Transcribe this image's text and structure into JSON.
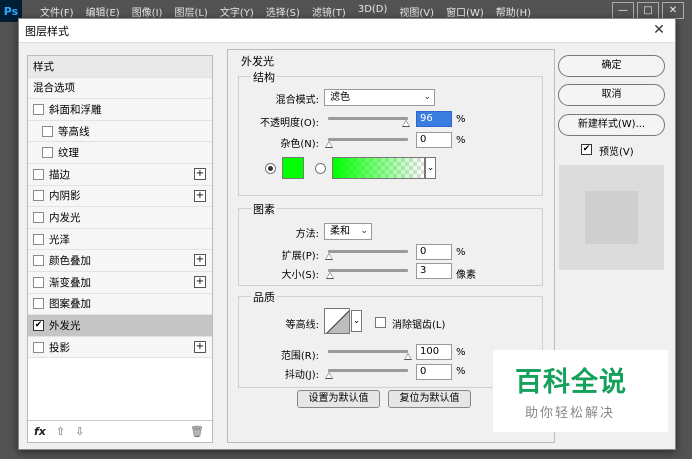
{
  "app": {
    "logo": "Ps",
    "menu": [
      "文件(F)",
      "编辑(E)",
      "图像(I)",
      "图层(L)",
      "文字(Y)",
      "选择(S)",
      "滤镜(T)",
      "3D(D)",
      "视图(V)",
      "窗口(W)",
      "帮助(H)"
    ],
    "window_controls": [
      "—",
      "□",
      "✕"
    ]
  },
  "dialog": {
    "title": "图层样式",
    "close": "✕",
    "style_list": {
      "header": "样式",
      "blend": "混合选项",
      "items": [
        {
          "label": "斜面和浮雕",
          "checked": false,
          "plus": false,
          "indent": false
        },
        {
          "label": "等高线",
          "checked": false,
          "plus": false,
          "indent": true
        },
        {
          "label": "纹理",
          "checked": false,
          "plus": false,
          "indent": true
        },
        {
          "label": "描边",
          "checked": false,
          "plus": true,
          "indent": false
        },
        {
          "label": "内阴影",
          "checked": false,
          "plus": true,
          "indent": false
        },
        {
          "label": "内发光",
          "checked": false,
          "plus": false,
          "indent": false
        },
        {
          "label": "光泽",
          "checked": false,
          "plus": false,
          "indent": false
        },
        {
          "label": "颜色叠加",
          "checked": false,
          "plus": true,
          "indent": false
        },
        {
          "label": "渐变叠加",
          "checked": false,
          "plus": true,
          "indent": false
        },
        {
          "label": "图案叠加",
          "checked": false,
          "plus": false,
          "indent": false
        },
        {
          "label": "外发光",
          "checked": true,
          "plus": false,
          "indent": false
        },
        {
          "label": "投影",
          "checked": false,
          "plus": true,
          "indent": false
        }
      ],
      "footer": {
        "fx": "fx",
        "up": "⇧",
        "down": "⇩",
        "trash": "🗑"
      }
    },
    "panel_title": "外发光",
    "structure": {
      "title": "结构",
      "blend_mode_label": "混合模式:",
      "blend_mode_value": "滤色",
      "opacity_label": "不透明度(O):",
      "opacity_value": "96",
      "noise_label": "杂色(N):",
      "noise_value": "0",
      "percent": "%",
      "color": "#00ff00",
      "gradient_color": "#00ff00"
    },
    "elements": {
      "title": "图素",
      "method_label": "方法:",
      "method_value": "柔和",
      "spread_label": "扩展(P):",
      "spread_value": "0",
      "size_label": "大小(S):",
      "size_value": "3",
      "px_unit": "像素",
      "percent": "%"
    },
    "quality": {
      "title": "品质",
      "contour_label": "等高线:",
      "antialias_label": "消除锯齿(L)",
      "range_label": "范围(R):",
      "range_value": "100",
      "jitter_label": "抖动(J):",
      "jitter_value": "0",
      "percent": "%"
    },
    "buttons": {
      "set_default": "设置为默认值",
      "reset_default": "复位为默认值",
      "ok": "确定",
      "cancel": "取消",
      "new_style": "新建样式(W)...",
      "preview_label": "预览(V)"
    }
  },
  "watermark": {
    "main": "百科全说",
    "sub": "助你轻松解决"
  }
}
